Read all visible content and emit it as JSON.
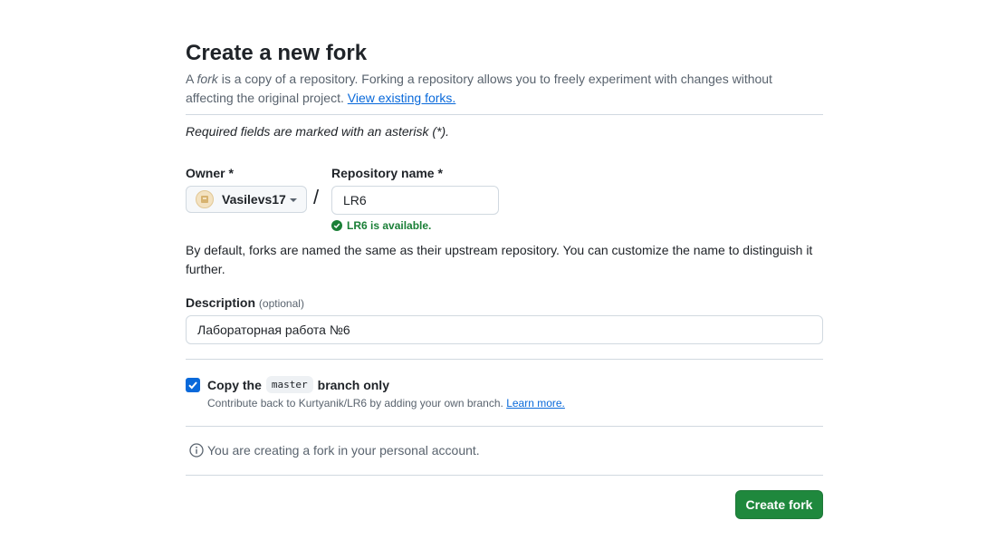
{
  "header": {
    "title": "Create a new fork",
    "subtitle_pre": "A ",
    "subtitle_em": "fork",
    "subtitle_post": " is a copy of a repository. Forking a repository allows you to freely experiment with changes without affecting the original project. ",
    "subtitle_link": "View existing forks."
  },
  "required_note": "Required fields are marked with an asterisk (*).",
  "owner": {
    "label": "Owner *",
    "value": "Vasilevs17"
  },
  "repository": {
    "label": "Repository name *",
    "value": "LR6",
    "availability": "LR6 is available."
  },
  "naming_note": "By default, forks are named the same as their upstream repository. You can customize the name to distinguish it further.",
  "description": {
    "label": "Description",
    "optional": "(optional)",
    "value": "Лабораторная работа №6"
  },
  "copy_branch": {
    "checked": true,
    "label_pre": "Copy the",
    "branch": "master",
    "label_post": "branch only",
    "sub_text": "Contribute back to Kurtyanik/LR6 by adding your own branch. ",
    "sub_link": "Learn more."
  },
  "info_text": "You are creating a fork in your personal account.",
  "submit_label": "Create fork",
  "colors": {
    "primary_button": "#1f883d",
    "link": "#0969da",
    "success": "#1a7f37"
  }
}
